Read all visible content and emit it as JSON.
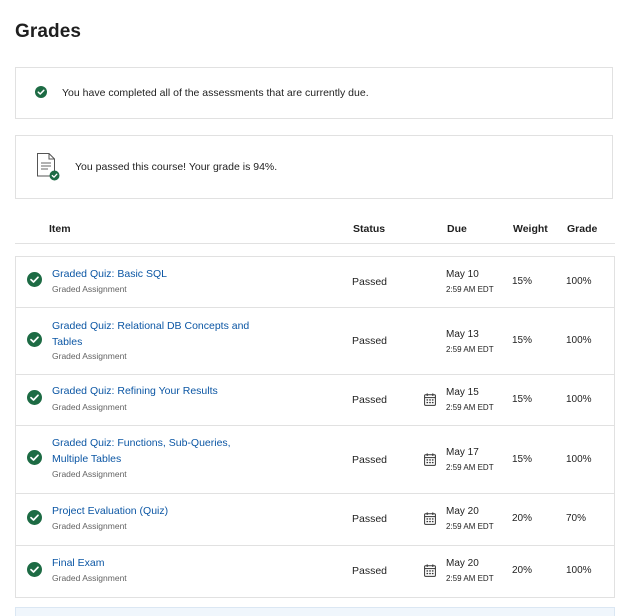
{
  "page": {
    "title": "Grades"
  },
  "notices": {
    "completed_text": "You have completed all of the assessments that are currently due.",
    "passed_text": "You passed this course! Your grade is 94%."
  },
  "table": {
    "headers": {
      "item": "Item",
      "status": "Status",
      "due": "Due",
      "weight": "Weight",
      "grade": "Grade"
    },
    "rows": [
      {
        "title": "Graded Quiz: Basic SQL",
        "type": "Graded Assignment",
        "status": "Passed",
        "due_date": "May 10",
        "due_time": "2:59 AM EDT",
        "weight": "15%",
        "grade": "100%",
        "calendar_icon": false
      },
      {
        "title": "Graded Quiz: Relational DB Concepts and Tables",
        "type": "Graded Assignment",
        "status": "Passed",
        "due_date": "May 13",
        "due_time": "2:59 AM EDT",
        "weight": "15%",
        "grade": "100%",
        "calendar_icon": false
      },
      {
        "title": "Graded Quiz: Refining Your Results",
        "type": "Graded Assignment",
        "status": "Passed",
        "due_date": "May 15",
        "due_time": "2:59 AM EDT",
        "weight": "15%",
        "grade": "100%",
        "calendar_icon": true
      },
      {
        "title": "Graded Quiz: Functions, Sub-Queries, Multiple Tables",
        "type": "Graded Assignment",
        "status": "Passed",
        "due_date": "May 17",
        "due_time": "2:59 AM EDT",
        "weight": "15%",
        "grade": "100%",
        "calendar_icon": true
      },
      {
        "title": "Project Evaluation (Quiz)",
        "type": "Graded Assignment",
        "status": "Passed",
        "due_date": "May 20",
        "due_time": "2:59 AM EDT",
        "weight": "20%",
        "grade": "70%",
        "calendar_icon": true
      },
      {
        "title": "Final Exam",
        "type": "Graded Assignment",
        "status": "Passed",
        "due_date": "May 20",
        "due_time": "2:59 AM EDT",
        "weight": "20%",
        "grade": "100%",
        "calendar_icon": true
      }
    ]
  },
  "colors": {
    "success_green": "#1d6b44",
    "link_blue": "#0b56a4",
    "border": "#e1e1e1"
  },
  "icons": {
    "check": "check-circle-icon",
    "document": "document-check-icon",
    "calendar": "calendar-icon"
  }
}
